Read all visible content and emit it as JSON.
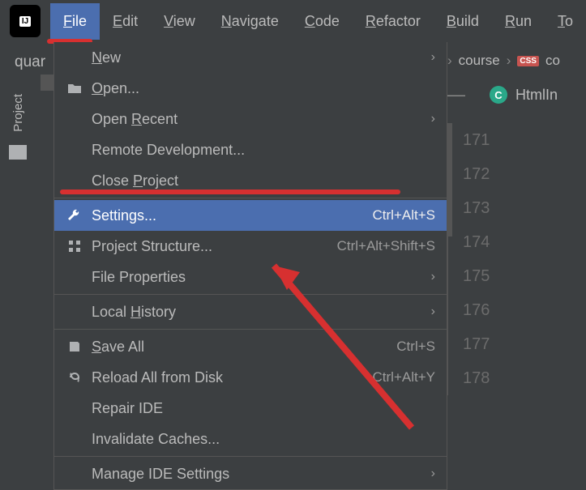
{
  "app_icon_text": "IJ",
  "menubar": {
    "items": [
      "File",
      "Edit",
      "View",
      "Navigate",
      "Code",
      "Refactor",
      "Build",
      "Run",
      "To"
    ],
    "active_index": 0
  },
  "project_name": "quar",
  "left_rail": {
    "label": "Project"
  },
  "breadcrumbs": {
    "item1": "course",
    "item2": "co",
    "badge": "CSS"
  },
  "editor": {
    "tab_badge": "C",
    "tab_name": "HtmlIn",
    "gutter_lines": [
      "171",
      "172",
      "173",
      "174",
      "175",
      "176",
      "177",
      "178"
    ]
  },
  "file_menu": {
    "items": [
      {
        "label": "New",
        "icon": "",
        "arrow": true
      },
      {
        "label": "Open...",
        "icon": "folder",
        "u": 0
      },
      {
        "label": "Open Recent",
        "icon": "",
        "arrow": true,
        "upos": 5
      },
      {
        "label": "Remote Development...",
        "icon": ""
      },
      {
        "label": "Close Project",
        "icon": "",
        "upos": 6
      },
      {
        "sep": true
      },
      {
        "label": "Settings...",
        "icon": "wrench",
        "shortcut": "Ctrl+Alt+S",
        "selected": true
      },
      {
        "label": "Project Structure...",
        "icon": "structure",
        "shortcut": "Ctrl+Alt+Shift+S"
      },
      {
        "label": "File Properties",
        "icon": "",
        "arrow": true
      },
      {
        "sep": true
      },
      {
        "label": "Local History",
        "icon": "",
        "arrow": true,
        "upos": 6
      },
      {
        "sep": true
      },
      {
        "label": "Save All",
        "icon": "save",
        "shortcut": "Ctrl+S",
        "upos": 0
      },
      {
        "label": "Reload All from Disk",
        "icon": "reload",
        "shortcut": "Ctrl+Alt+Y"
      },
      {
        "label": "Repair IDE",
        "icon": ""
      },
      {
        "label": "Invalidate Caches...",
        "icon": ""
      },
      {
        "sep": true
      },
      {
        "label": "Manage IDE Settings",
        "icon": "",
        "arrow": true
      }
    ]
  }
}
